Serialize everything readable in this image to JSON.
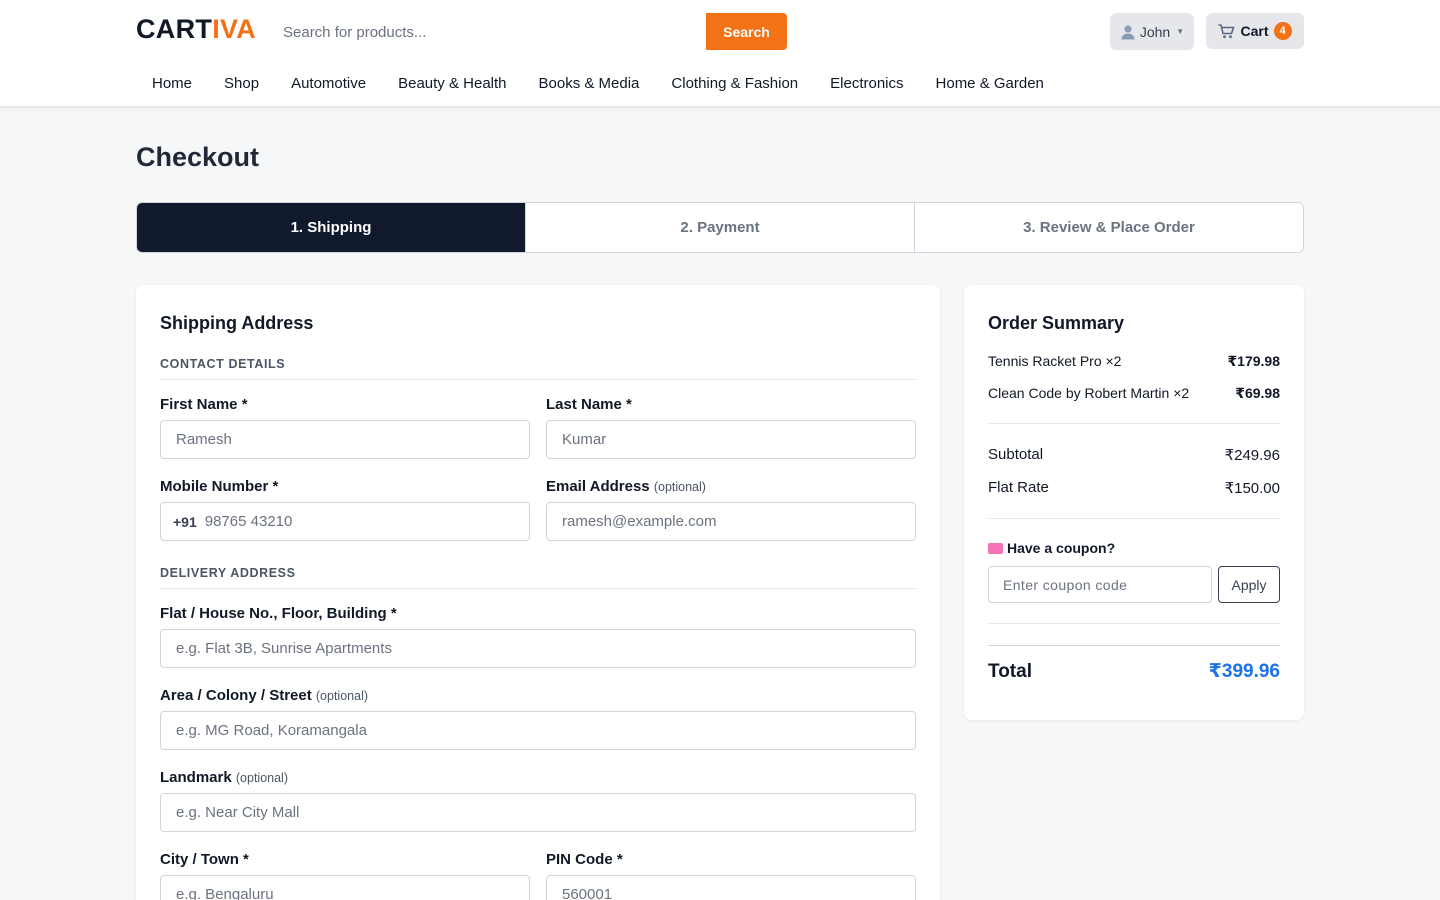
{
  "brand": {
    "logo_main": "CART",
    "logo_accent": "IVA",
    "accent_color": "#f47216"
  },
  "search": {
    "placeholder": "Search for products...",
    "button_label": "Search"
  },
  "user": {
    "name": "John",
    "icon": "user-icon"
  },
  "cart": {
    "label": "Cart",
    "count": "4",
    "icon": "cart-icon"
  },
  "nav": {
    "items": [
      {
        "label": "Home"
      },
      {
        "label": "Shop"
      },
      {
        "label": "Automotive"
      },
      {
        "label": "Beauty & Health"
      },
      {
        "label": "Books & Media"
      },
      {
        "label": "Clothing & Fashion"
      },
      {
        "label": "Electronics"
      },
      {
        "label": "Home & Garden"
      }
    ]
  },
  "page": {
    "title": "Checkout"
  },
  "steps": [
    {
      "label": "1. Shipping",
      "active": true
    },
    {
      "label": "2. Payment",
      "active": false
    },
    {
      "label": "3. Review & Place Order",
      "active": false
    }
  ],
  "shipping": {
    "title": "Shipping Address",
    "contact_heading": "CONTACT DETAILS",
    "first_name": {
      "label": "First Name *",
      "placeholder": "Ramesh"
    },
    "last_name": {
      "label": "Last Name *",
      "placeholder": "Kumar"
    },
    "mobile": {
      "label": "Mobile Number *",
      "prefix": "+91",
      "placeholder": "98765 43210"
    },
    "email": {
      "label": "Email Address",
      "optional": "(optional)",
      "placeholder": "ramesh@example.com"
    },
    "delivery_heading": "DELIVERY ADDRESS",
    "flat": {
      "label": "Flat / House No., Floor, Building *",
      "placeholder": "e.g. Flat 3B, Sunrise Apartments"
    },
    "area": {
      "label": "Area / Colony / Street",
      "optional": "(optional)",
      "placeholder": "e.g. MG Road, Koramangala"
    },
    "landmark": {
      "label": "Landmark",
      "optional": "(optional)",
      "placeholder": "e.g. Near City Mall"
    },
    "city": {
      "label": "City / Town *",
      "placeholder": "e.g. Bengaluru"
    },
    "pin": {
      "label": "PIN Code *",
      "placeholder": "560001"
    }
  },
  "summary": {
    "title": "Order Summary",
    "items": [
      {
        "name": "Tennis Racket Pro ×2",
        "amount": "₹179.98"
      },
      {
        "name": "Clean Code by Robert Martin ×2",
        "amount": "₹69.98"
      }
    ],
    "subtotal": {
      "label": "Subtotal",
      "amount": "₹249.96"
    },
    "shipping_fee": {
      "label": "Flat Rate",
      "amount": "₹150.00"
    },
    "coupon": {
      "label": "Have a coupon?",
      "icon": "ticket-icon",
      "placeholder": "Enter coupon code",
      "button_label": "Apply"
    },
    "total": {
      "label": "Total",
      "amount": "₹399.96",
      "color": "#1d72e8"
    }
  }
}
